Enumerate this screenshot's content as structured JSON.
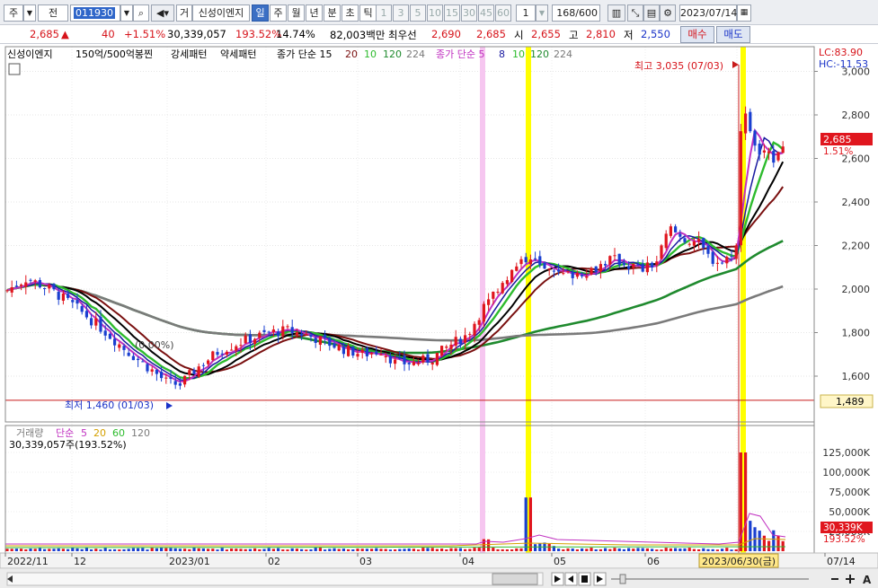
{
  "toolbar": {
    "market": "주",
    "prefix": "전",
    "code": "011930",
    "trade_btn": "거",
    "stock_name": "신성이엔지",
    "periods": [
      "일",
      "주",
      "월",
      "년",
      "분",
      "초",
      "틱"
    ],
    "selected_period": "일",
    "intervals": [
      "1",
      "3",
      "5",
      "10",
      "15",
      "30",
      "45",
      "60"
    ],
    "count_value": "1",
    "range": "168/600",
    "date": "2023/07/14"
  },
  "info": {
    "price": "2,685",
    "arrow": "▲",
    "change": "40",
    "change_pct": "+1.51%",
    "volume": "30,339,057",
    "volume_ratio": "193.52%",
    "turnover": "14.74%",
    "trade_value": "82,003백만",
    "best_bid_label": "최우선",
    "best_ask": "2,690",
    "best_bid": "2,685",
    "open_label": "시",
    "open": "2,655",
    "high_label": "고",
    "high": "2,810",
    "low_label": "저",
    "low": "2,550",
    "buy_button": "매수",
    "sell_button": "매도"
  },
  "legend": {
    "items": [
      "신성이엔지",
      "150억/500억봉찐",
      "강세패턴",
      "약세패턴",
      "종가 단순 15",
      "20",
      "10",
      "120",
      "224",
      "종가 단순 5",
      "8",
      "10",
      "120",
      "224"
    ],
    "lc": "LC:83.90",
    "hc": "HC:-11.53"
  },
  "annotations": {
    "high": "최고 3,035 (07/03)",
    "low": "최저 1,460 (01/03)",
    "mid": "(0.00%)",
    "last_price": "2,685",
    "last_pct": "1.51%",
    "hline": "1,489"
  },
  "volume_legend": {
    "title": "거래량",
    "ma_label": "단순",
    "periods": [
      "5",
      "20",
      "60",
      "120"
    ],
    "value": "30,339,057주(193.52%)",
    "last": "30,339K",
    "last_pct": "193.52%"
  },
  "date_axis": {
    "labels": [
      "2022/11",
      "12",
      "2023/01",
      "02",
      "03",
      "04",
      "05",
      "06",
      "07/14"
    ],
    "cursor": "2023/06/30(금)"
  },
  "chart_data": {
    "type": "candlestick",
    "price_ticks": [
      "3,000",
      "2,800",
      "2,600",
      "2,400",
      "2,200",
      "2,000",
      "1,800",
      "1,600"
    ],
    "volume_ticks": [
      "125,000K",
      "100,000K",
      "75,000K",
      "50,000K",
      "25,000K"
    ],
    "highest": {
      "value": 3035,
      "date": "07/03"
    },
    "lowest": {
      "value": 1460,
      "date": "01/03"
    },
    "last": {
      "close": 2685,
      "open": 2655,
      "high": 2810,
      "low": 2550,
      "volume": 30339057
    },
    "colors": {
      "up": "#e0161e",
      "down": "#1a3fd0",
      "ma5": "#c030c0",
      "ma8": "#1a1aa0",
      "ma10": "#2dbb2d",
      "ma15": "#000000",
      "ma20": "#7a1010",
      "ma120": "#1f8a2e",
      "ma224": "#7a7a7a"
    }
  }
}
